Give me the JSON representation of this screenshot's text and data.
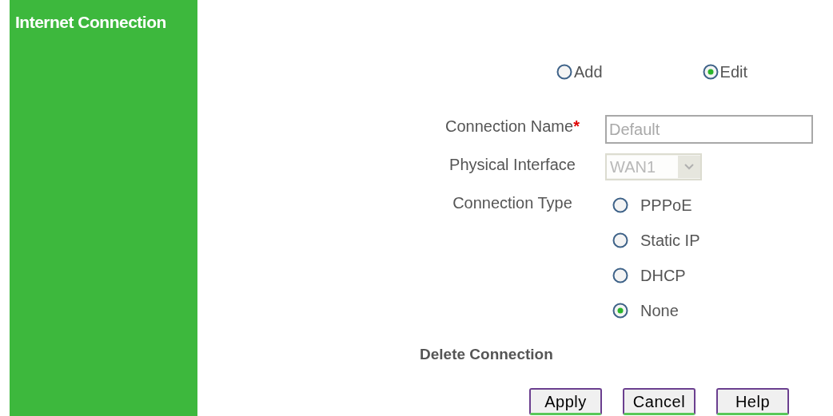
{
  "sidebar": {
    "title": "Internet Connection"
  },
  "mode": [
    {
      "label": "Add",
      "selected": false
    },
    {
      "label": "Edit",
      "selected": true
    }
  ],
  "form": {
    "connection_name": {
      "label": "Connection Name",
      "required_mark": "*",
      "value": "Default",
      "disabled": true
    },
    "physical_interface": {
      "label": "Physical Interface",
      "value": "WAN1",
      "disabled": true
    },
    "connection_type": {
      "label": "Connection Type",
      "options": [
        {
          "label": "PPPoE",
          "selected": false
        },
        {
          "label": "Static IP",
          "selected": false
        },
        {
          "label": "DHCP",
          "selected": false
        },
        {
          "label": "None",
          "selected": true
        }
      ]
    }
  },
  "delete_connection": "Delete Connection",
  "buttons": [
    "Apply",
    "Cancel",
    "Help"
  ]
}
